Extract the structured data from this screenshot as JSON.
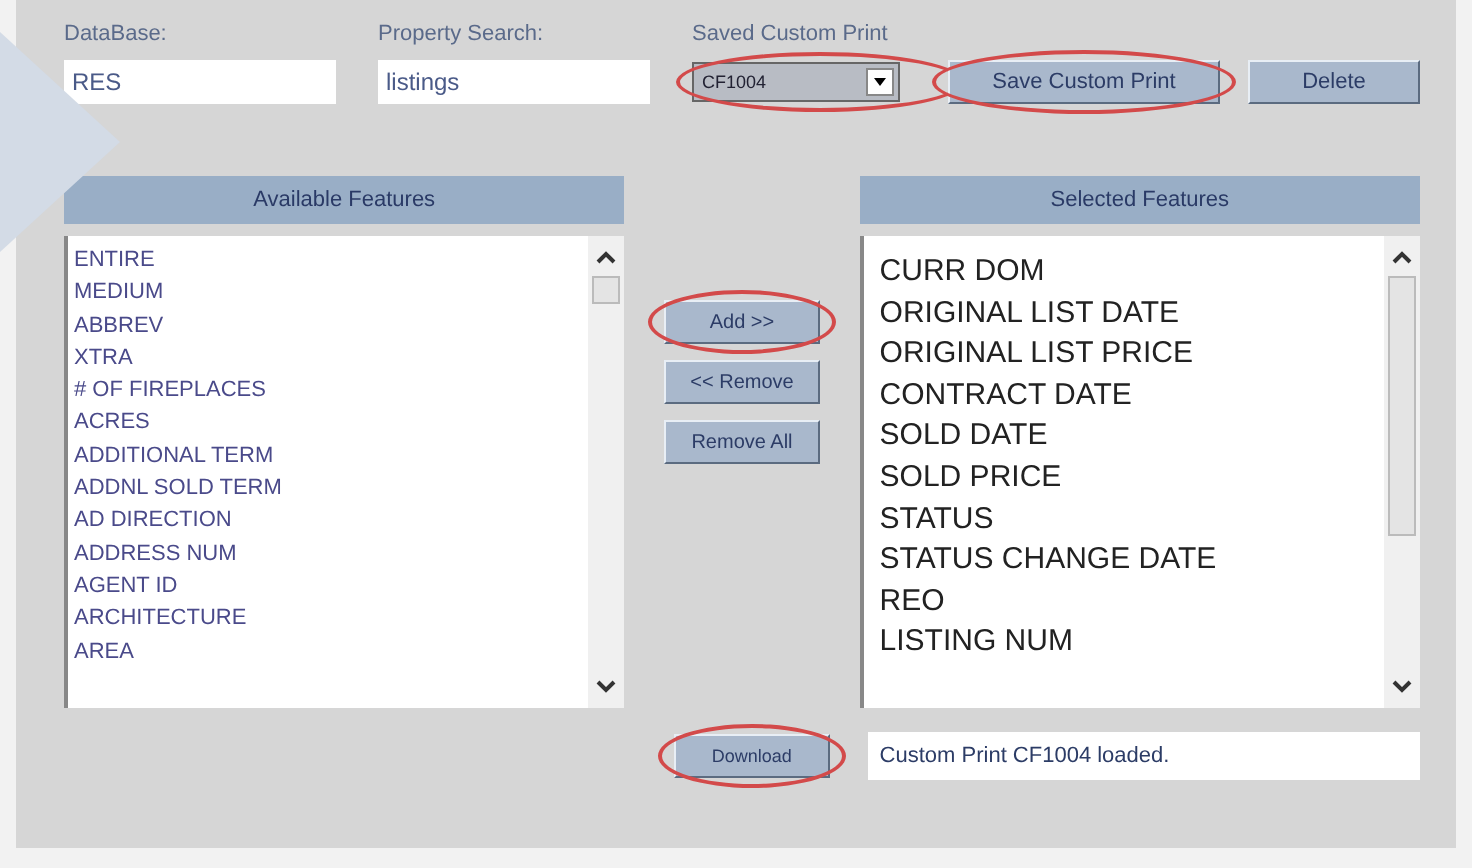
{
  "database": {
    "label": "DataBase:",
    "value": "RES"
  },
  "property_search": {
    "label": "Property Search:",
    "value": "listings"
  },
  "saved_custom_print": {
    "label": "Saved Custom Print",
    "value": "CF1004",
    "circled": true
  },
  "top_buttons": [
    {
      "label": "Save Custom Print",
      "circled": true
    },
    {
      "label": "Delete",
      "circled": false
    }
  ],
  "available": {
    "title": "Available Features",
    "items": [
      "ENTIRE",
      "MEDIUM",
      "ABBREV",
      "XTRA",
      "# OF FIREPLACES",
      "ACRES",
      "ADDITIONAL TERM",
      "ADDNL SOLD TERM",
      "AD DIRECTION",
      "ADDRESS NUM",
      "AGENT ID",
      "ARCHITECTURE",
      "AREA"
    ]
  },
  "middle_buttons": [
    {
      "label": "Add >>",
      "circled": true
    },
    {
      "label": "<< Remove",
      "circled": false
    },
    {
      "label": "Remove All",
      "circled": false
    }
  ],
  "selected": {
    "title": "Selected Features",
    "items": [
      "CURR DOM",
      "ORIGINAL LIST DATE",
      "ORIGINAL LIST PRICE",
      "CONTRACT DATE",
      "SOLD DATE",
      "SOLD PRICE",
      "STATUS",
      "STATUS CHANGE DATE",
      "REO",
      "LISTING NUM"
    ]
  },
  "download_button": {
    "label": "Download",
    "circled": true
  },
  "status_message": "Custom Print CF1004 loaded."
}
